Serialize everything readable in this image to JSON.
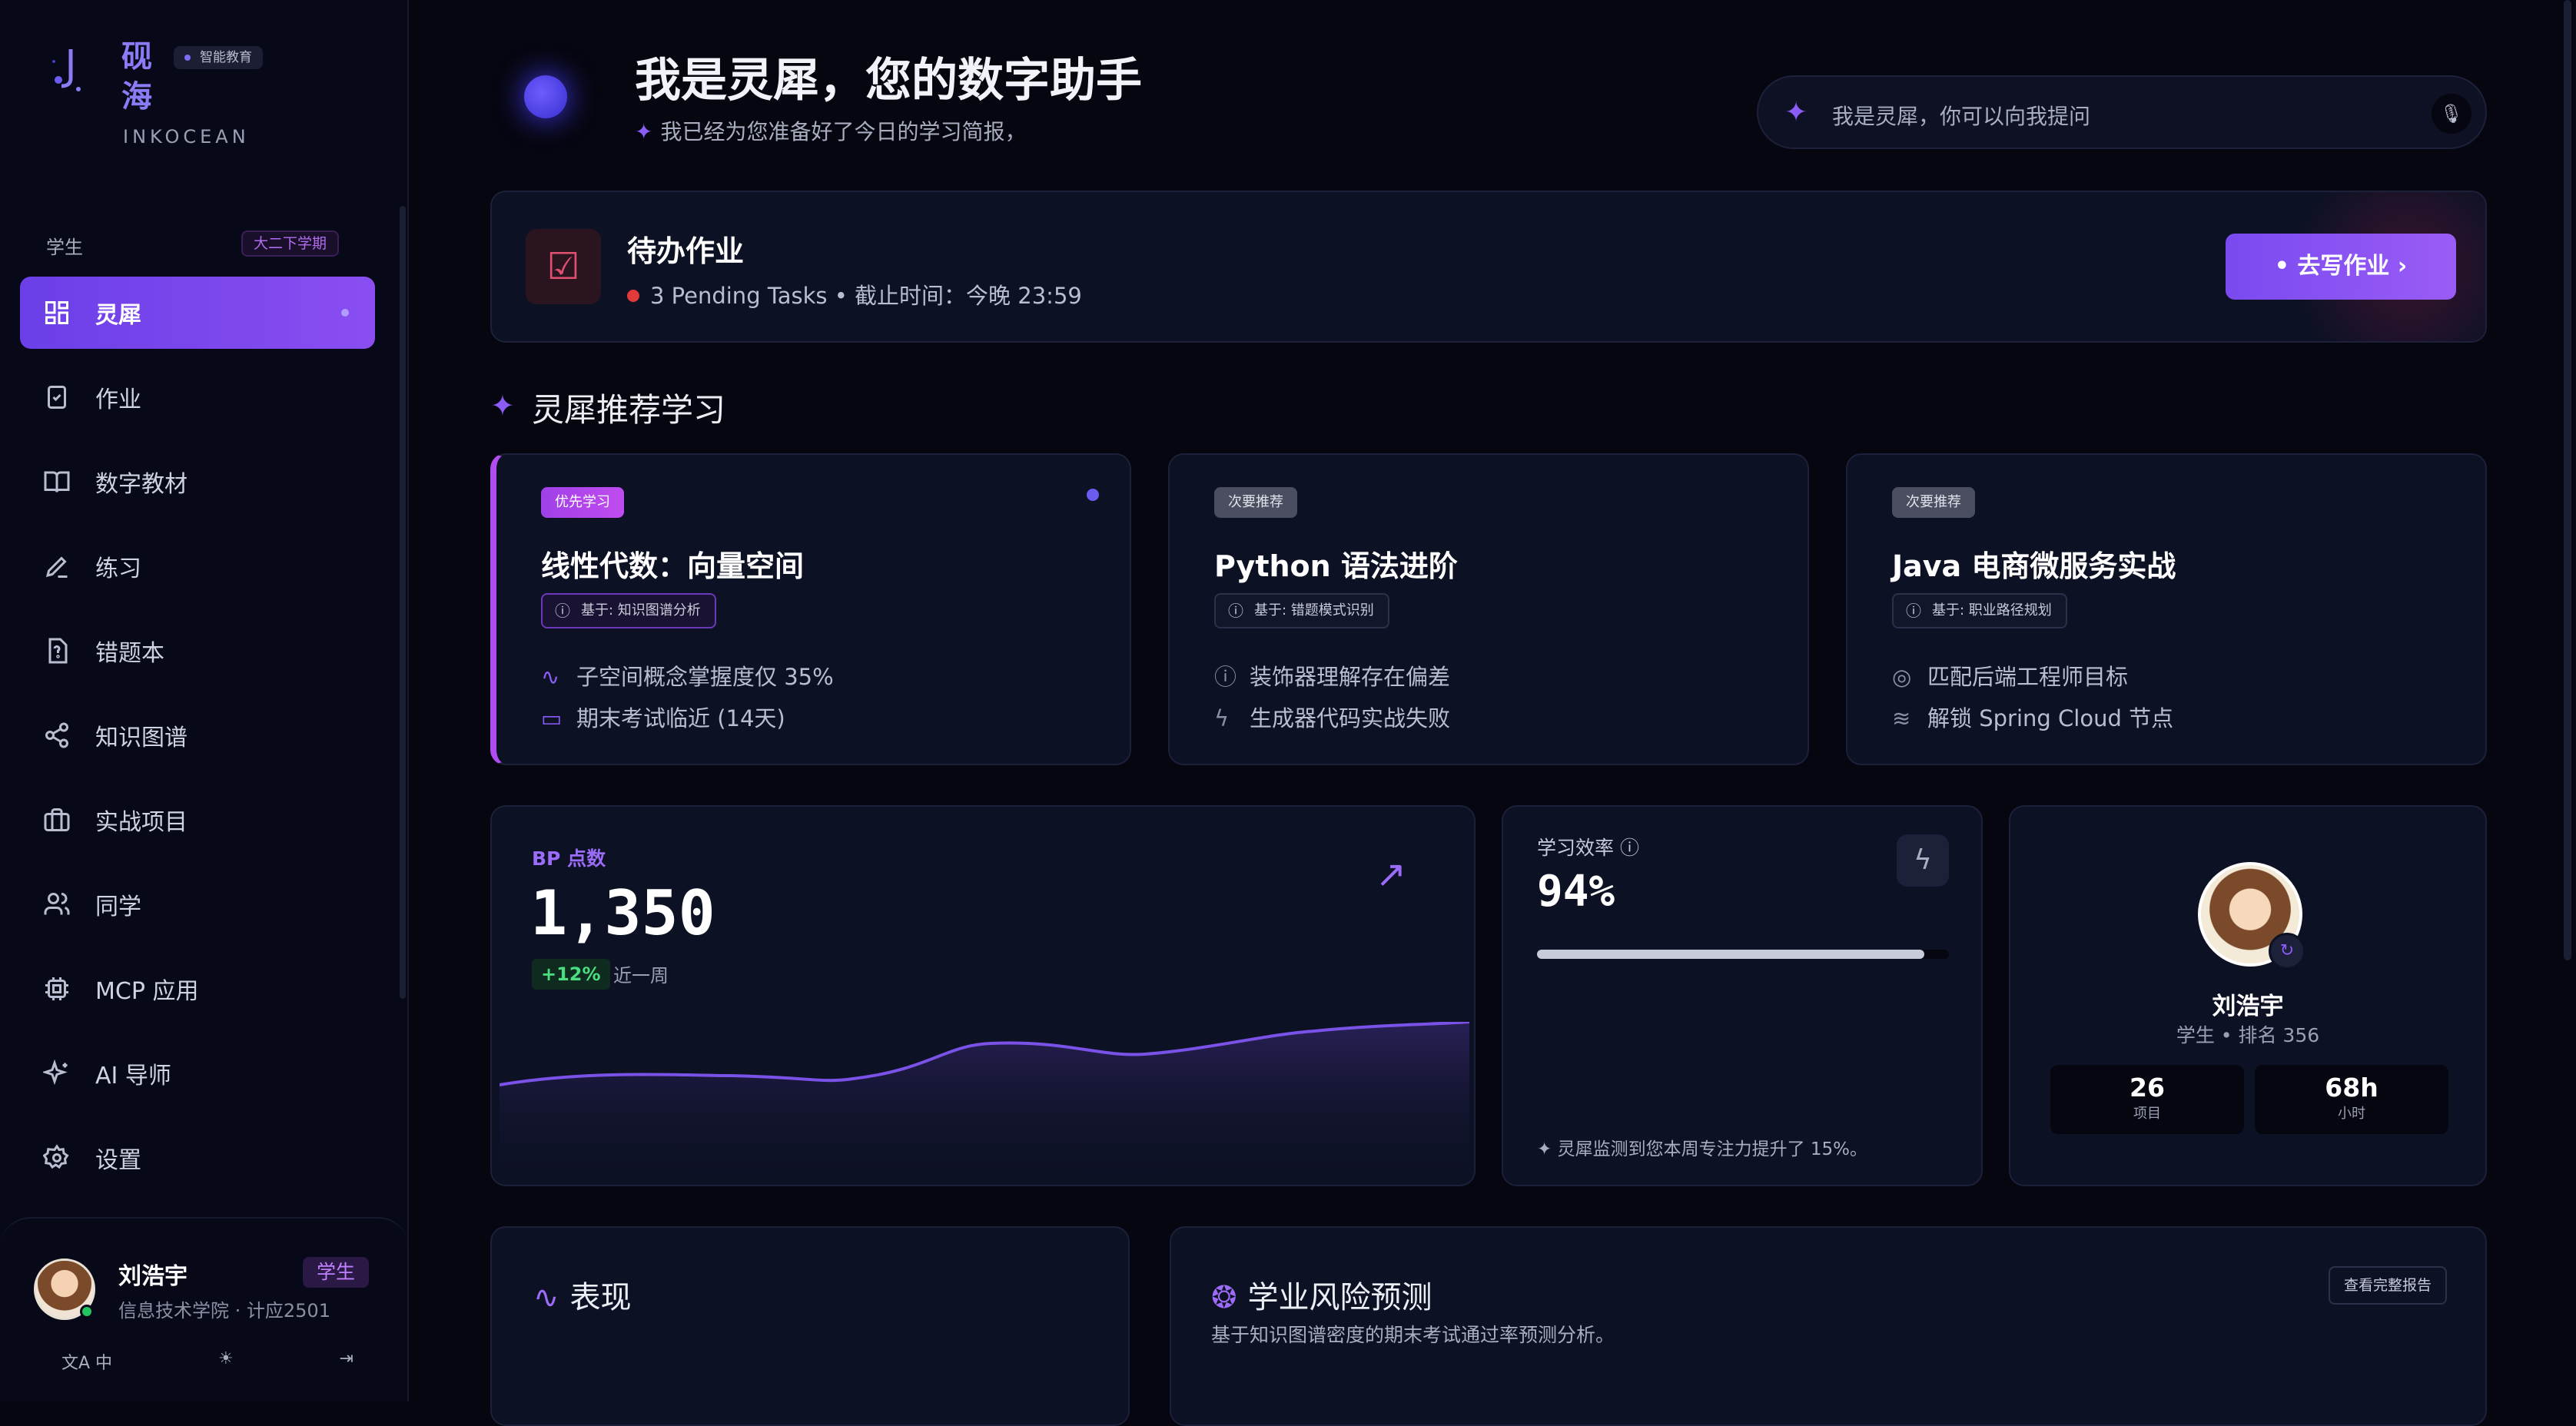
{
  "brand": {
    "name_cn": "砚海",
    "tag": "智能教育",
    "name_en": "INKOCEAN"
  },
  "sidebar": {
    "role": "学生",
    "term": "大二下学期",
    "items": [
      {
        "label": "灵犀",
        "icon": "grid-icon",
        "active": true
      },
      {
        "label": "作业",
        "icon": "clipboard-check-icon"
      },
      {
        "label": "数字教材",
        "icon": "book-open-icon"
      },
      {
        "label": "练习",
        "icon": "pencil-icon"
      },
      {
        "label": "错题本",
        "icon": "file-question-icon"
      },
      {
        "label": "知识图谱",
        "icon": "share-nodes-icon"
      },
      {
        "label": "实战项目",
        "icon": "briefcase-icon"
      },
      {
        "label": "同学",
        "icon": "users-icon"
      },
      {
        "label": "MCP 应用",
        "icon": "chip-icon"
      },
      {
        "label": "AI 导师",
        "icon": "sparkles-icon"
      },
      {
        "label": "设置",
        "icon": "gear-icon"
      }
    ],
    "user": {
      "name": "刘浩宇",
      "role": "学生",
      "dept": "信息技术学院 · 计应2501"
    },
    "actions": {
      "lang": "中"
    }
  },
  "hero": {
    "title": "我是灵犀，您的数字助手",
    "subtitle": "我已经为您准备好了今日的学习简报，"
  },
  "search": {
    "placeholder": "我是灵犀，你可以向我提问"
  },
  "homework": {
    "title": "待办作业",
    "meta": "3 Pending Tasks • 截止时间：今晚 23:59",
    "button": "去写作业"
  },
  "recommend": {
    "title": "灵犀推荐学习",
    "cards": [
      {
        "tag": "优先学习",
        "title": "线性代数：向量空间",
        "basis": "基于: 知识图谱分析",
        "lines": [
          "子空间概念掌握度仅 35%",
          "期末考试临近 (14天)"
        ]
      },
      {
        "tag": "次要推荐",
        "title": "Python 语法进阶",
        "basis": "基于: 错题模式识别",
        "lines": [
          "装饰器理解存在偏差",
          "生成器代码实战失败"
        ]
      },
      {
        "tag": "次要推荐",
        "title": "Java 电商微服务实战",
        "basis": "基于: 职业路径规划",
        "lines": [
          "匹配后端工程师目标",
          "解锁 Spring Cloud 节点"
        ]
      }
    ]
  },
  "bp": {
    "label": "BP 点数",
    "value": "1,350",
    "change": "+12%",
    "period": "近一周"
  },
  "efficiency": {
    "label": "学习效率",
    "value": "94%",
    "level": 0.94,
    "note": "灵犀监测到您本周专注力提升了 15%。"
  },
  "profile": {
    "name": "刘浩宇",
    "sub": "学生 • 排名 356",
    "stats": [
      {
        "value": "26",
        "label": "项目"
      },
      {
        "value": "68h",
        "label": "小时"
      }
    ]
  },
  "performance": {
    "title": "表现"
  },
  "risk": {
    "title": "学业风险预测",
    "subtitle": "基于知识图谱密度的期末考试通过率预测分析。",
    "button": "查看完整报告"
  },
  "colors": {
    "accent": "#8b5cf6",
    "background": "#05060f",
    "card": "#0d1124",
    "success": "#4ade80",
    "danger": "#e03a3a"
  }
}
